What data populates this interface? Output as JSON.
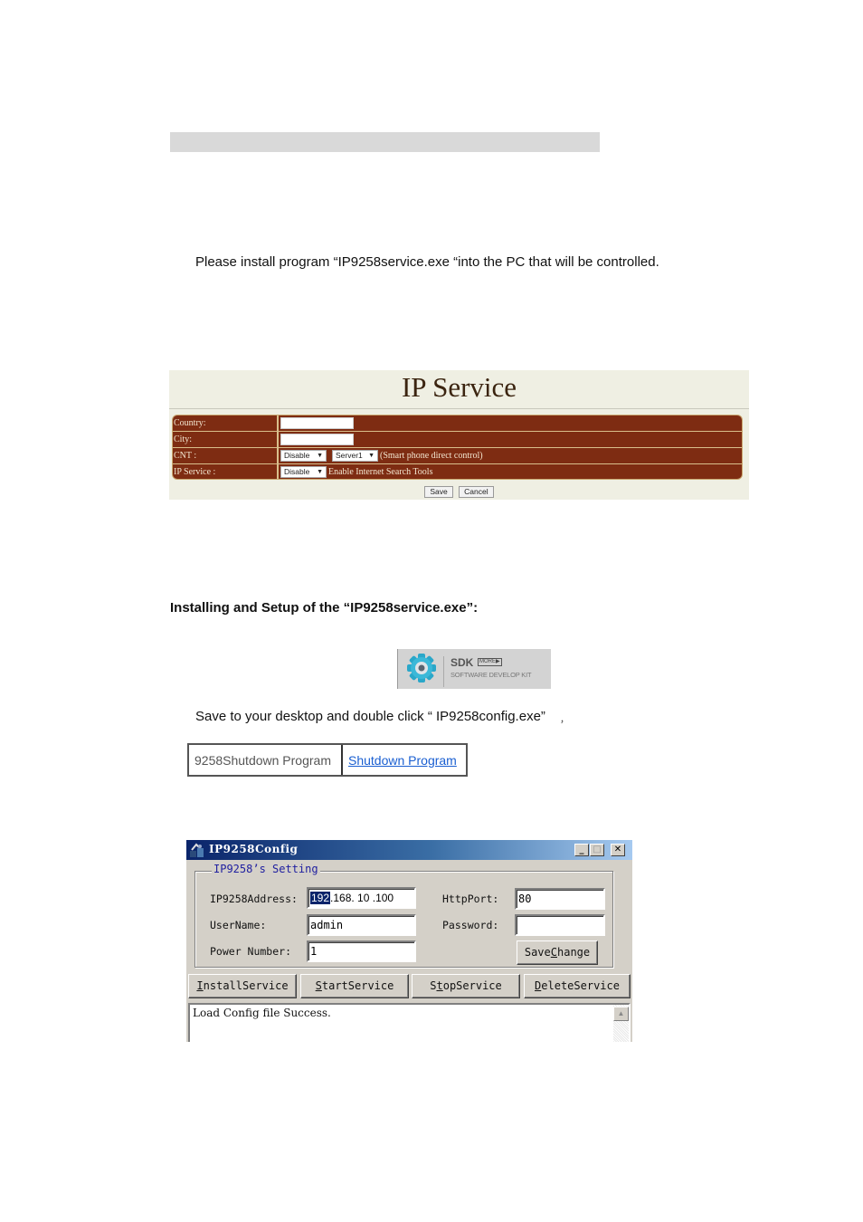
{
  "doc": {
    "install_text": "Please install program “IP9258service.exe “into the PC that will be controlled.",
    "setup_heading": "Installing and Setup of the “IP9258service.exe”:",
    "save_text": "Save to your desktop and double click “ IP9258config.exe”",
    "comma_mark": "，"
  },
  "ip_service": {
    "title": "IP Service",
    "rows": [
      {
        "label": "Country:",
        "value": ""
      },
      {
        "label": "City:",
        "value": ""
      },
      {
        "label": "CNT :",
        "select1": "Disable",
        "select2": "Server1",
        "note": "(Smart phone direct control)"
      },
      {
        "label": "IP Service :",
        "select1": "Disable",
        "note": "Enable Internet Search Tools"
      }
    ],
    "buttons": {
      "save": "Save",
      "cancel": "Cancel"
    },
    "colors": {
      "table_bg": "#7e2c12",
      "panel_bg": "#efefe3",
      "border": "#d9bf8c"
    }
  },
  "sdk_badge": {
    "title": "SDK",
    "more": "MORE▶",
    "subtitle": "SOFTWARE DEVELOP KIT",
    "icon": "gear-icon"
  },
  "shutdown_table": {
    "name": "9258Shutdown Program",
    "link": "Shutdown Program"
  },
  "config_window": {
    "title": "IP9258Config",
    "controls": {
      "minimize": "_",
      "maximize": "□",
      "close": "✕"
    },
    "group_label": "IP9258’s Setting",
    "fields": {
      "address_label": "IP9258Address:",
      "address_octets": [
        "192",
        ".168",
        ". 10",
        " .100"
      ],
      "httpport_label": "HttpPort:",
      "httpport_value": "80",
      "username_label": "UserName:",
      "username_value": "admin",
      "password_label": "Password:",
      "password_value": "",
      "power_label": "Power Number:",
      "power_value": "1"
    },
    "save_change": {
      "pre": "Save",
      "accel": "C",
      "post": "hange"
    },
    "buttons": [
      {
        "accel": "I",
        "rest": "nstallService"
      },
      {
        "accel": "S",
        "rest": "tartService"
      },
      {
        "pre": "S",
        "accel": "t",
        "rest": "opService"
      },
      {
        "accel": "D",
        "rest": "eleteService"
      }
    ],
    "log": "Load Config file Success."
  }
}
